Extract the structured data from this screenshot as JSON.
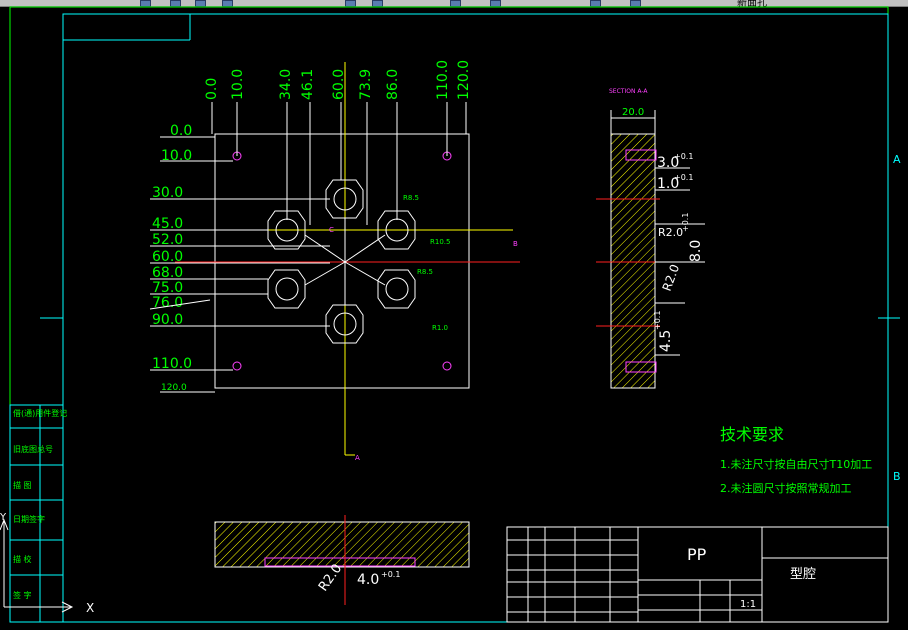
{
  "toolbar": {
    "layer_label": "新面孔"
  },
  "drawing": {
    "left_dims": [
      "0.0",
      "10.0",
      "30.0",
      "45.0",
      "52.0",
      "60.0",
      "68.0",
      "75.0",
      "76.0",
      "90.0",
      "110.0",
      "120.0"
    ],
    "top_dims": [
      "0.0",
      "10.0",
      "34.0",
      "46.1",
      "60.0",
      "73.9",
      "86.0",
      "110.0",
      "120.0"
    ],
    "section_label": "SECTION A-A",
    "section_marker": "A",
    "point_b": "B",
    "point_c": "C",
    "width_dim": "20.0",
    "right_dims": [
      "3.0",
      "1.0",
      "R2.0",
      "8.0",
      "R2.0",
      "4.5"
    ],
    "tolerance": "+0.1",
    "small_dims": [
      "R8.5",
      "R10.5",
      "R8.5",
      "R1.0"
    ],
    "bottom_dims": [
      "R2.0",
      "4.0"
    ],
    "tech_title": "技术要求",
    "tech_notes": [
      "1.未注尺寸按自由尺寸T10加工",
      "2.未注圆尺寸按照常规加工"
    ],
    "title_block": {
      "material": "PP",
      "part_name": "型腔",
      "scale": "1:1"
    },
    "zone_letters": [
      "A",
      "B"
    ],
    "left_strip": [
      "借(通)用件登记",
      "旧底图总号",
      "描  图",
      "描  校",
      "日期签字",
      "签  字"
    ],
    "ucs_x": "X",
    "ucs_y": "Y"
  },
  "colors": {
    "green": "#00ff00",
    "white": "#ffffff",
    "cyan": "#00ffff",
    "yellow": "#ffff00",
    "red": "#ff2020",
    "magenta": "#ff40ff"
  }
}
